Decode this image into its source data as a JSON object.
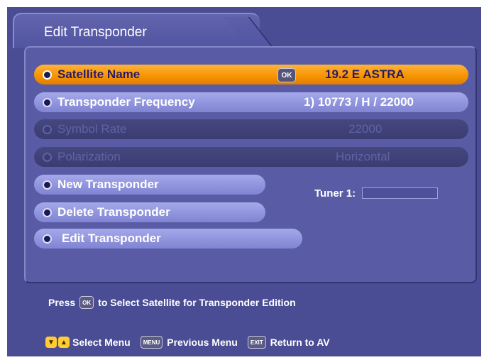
{
  "tab": {
    "title": "Edit Transponder"
  },
  "menu": {
    "satellite_name": {
      "label": "Satellite Name",
      "ok": "OK",
      "value": "19.2 E ASTRA"
    },
    "transponder_frequency": {
      "label": "Transponder Frequency",
      "value": "1) 10773 / H / 22000"
    },
    "symbol_rate": {
      "label": "Symbol Rate",
      "value": "22000"
    },
    "polarization": {
      "label": "Polarization",
      "value": "Horizontal"
    },
    "new_transponder": {
      "label": "New Transponder"
    },
    "delete_transponder": {
      "label": "Delete Transponder"
    },
    "edit_transponder": {
      "label": "Edit Transponder"
    }
  },
  "tuner": {
    "label": "Tuner 1:"
  },
  "hint": {
    "press": "Press",
    "ok": "OK",
    "text": "to Select Satellite for Transponder Edition"
  },
  "footer": {
    "select_menu": "Select Menu",
    "menu_key": "MENU",
    "previous_menu": "Previous Menu",
    "exit_key": "EXIT",
    "return_av": "Return to AV"
  },
  "colors": {
    "background": "#4a4d93",
    "selected_row": "#f59300",
    "active_row": "#8c90d9",
    "disabled_row": "#3e4077"
  }
}
